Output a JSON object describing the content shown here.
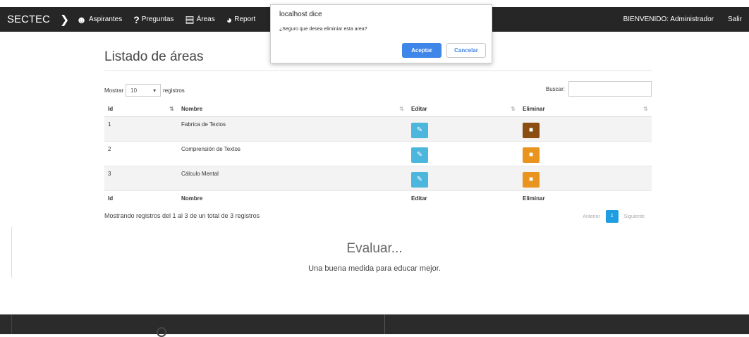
{
  "nav": {
    "brand": "SECTEC",
    "items": [
      {
        "label": "Aspirantes",
        "icon": "users-icon"
      },
      {
        "label": "Preguntas",
        "icon": "question-icon"
      },
      {
        "label": "Áreas",
        "icon": "book-icon"
      },
      {
        "label": "Report",
        "icon": "pie-chart-icon"
      }
    ],
    "welcome": "BIENVENIDO: Administrador",
    "logout": "Salir"
  },
  "page": {
    "title": "Listado de áreas",
    "show_label": "Mostrar",
    "show_value": "10",
    "records_label": "registros",
    "search_label": "Buscar:",
    "search_value": ""
  },
  "table": {
    "headers": [
      "Id",
      "Nombre",
      "Editar",
      "Eliminar"
    ],
    "rows": [
      {
        "id": "1",
        "name": "Fabrica de Textos"
      },
      {
        "id": "2",
        "name": "Comprensión de Textos"
      },
      {
        "id": "3",
        "name": "Cálculo Mental"
      }
    ]
  },
  "footer_info": "Mostrando registros del 1 al 3 de un total de 3 registros",
  "pager": {
    "prev": "Anterior",
    "current": "1",
    "next": "Siguiente"
  },
  "slogan": {
    "title": "Evaluar...",
    "subtitle": "Una buena medida para educar mejor."
  },
  "dialog": {
    "title": "localhost dice",
    "message": "¿Seguro que desea eliminiar esta area?",
    "ok": "Aceptar",
    "cancel": "Cancelar"
  },
  "colors": {
    "edit": "#4db6dc",
    "delete": "#e8941e",
    "delete_active": "#8a4d12",
    "accent": "#3e86e8"
  }
}
